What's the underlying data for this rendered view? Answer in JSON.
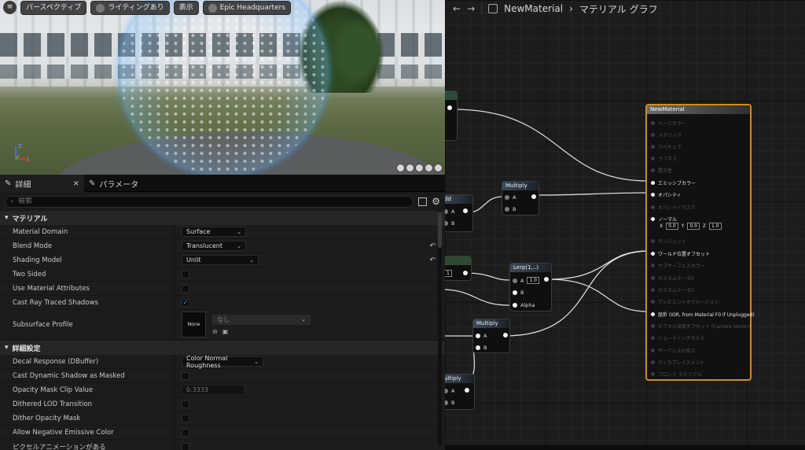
{
  "viewport": {
    "toolbar": [
      {
        "label": "パースペクティブ"
      },
      {
        "label": "ライティングあり"
      },
      {
        "label": "表示"
      },
      {
        "label": "Epic Headquarters"
      }
    ],
    "axis": {
      "z": "Z",
      "x": "X"
    }
  },
  "details": {
    "tabs": [
      {
        "label": "詳細",
        "close": "×"
      },
      {
        "label": "パラメータ"
      }
    ],
    "search_placeholder": "検索",
    "section_material": "マテリアル",
    "section_advanced": "詳細設定",
    "rows_material": [
      {
        "label": "Material Domain",
        "type": "dropdown",
        "value": "Surface",
        "reset": false
      },
      {
        "label": "Blend Mode",
        "type": "dropdown",
        "value": "Translucent",
        "reset": true
      },
      {
        "label": "Shading Model",
        "type": "dropdown",
        "value": "Unlit",
        "reset": true
      },
      {
        "label": "Two Sided",
        "type": "checkbox",
        "checked": false
      },
      {
        "label": "Use Material Attributes",
        "type": "checkbox",
        "checked": false
      },
      {
        "label": "Cast Ray Traced Shadows",
        "type": "checkbox",
        "checked": true
      }
    ],
    "subsurface": {
      "label": "Subsurface Profile",
      "thumb": "None",
      "dropdown": "なし"
    },
    "rows_advanced": [
      {
        "label": "Decal Response (DBuffer)",
        "type": "dropdown",
        "value": "Color Normal Roughness"
      },
      {
        "label": "Cast Dynamic Shadow as Masked",
        "type": "checkbox",
        "checked": false
      },
      {
        "label": "Opacity Mask Clip Value",
        "type": "number",
        "value": "0.3333"
      },
      {
        "label": "Dithered LOD Transition",
        "type": "checkbox",
        "checked": false
      },
      {
        "label": "Dither Opacity Mask",
        "type": "checkbox",
        "checked": false
      },
      {
        "label": "Allow Negative Emissive Color",
        "type": "checkbox",
        "checked": false
      },
      {
        "label": "ピクセルアニメーションがある",
        "type": "checkbox",
        "checked": false
      }
    ]
  },
  "graph": {
    "breadcrumb_material": "NewMaterial",
    "breadcrumb_sep": "›",
    "breadcrumb_graph": "マテリアル グラフ",
    "nodes": {
      "multiply_1": {
        "title": "Multiply",
        "a": "A",
        "b": "B"
      },
      "lerp": {
        "title": "Lerp(1,..)",
        "a": "A",
        "a_val": "1.0",
        "b": "B",
        "alpha": "Alpha"
      },
      "multiply_2": {
        "title": "Multiply",
        "a": "A",
        "b": "B"
      },
      "add_partial": {
        "title": "dd",
        "a": "A",
        "b": "B"
      },
      "multiply_partial": {
        "title": "ultiply",
        "a": "A",
        "b": "B"
      },
      "const_partial": {
        "value": "1"
      }
    },
    "main_node": {
      "title": "NewMaterial",
      "pins": [
        {
          "label": "ベースカラー",
          "active": false
        },
        {
          "label": "メタリック",
          "active": false
        },
        {
          "label": "スペキュラ",
          "active": false
        },
        {
          "label": "ラフネス",
          "active": false
        },
        {
          "label": "異方性",
          "active": false
        },
        {
          "label": "エミッシブカラー",
          "active": true
        },
        {
          "label": "オパシティ",
          "active": true
        },
        {
          "label": "オパシティマスク",
          "active": false
        },
        {
          "label": "ノーマル",
          "active": true
        },
        {
          "label": "タンジェント",
          "active": false
        },
        {
          "label": "ワールド位置オフセット",
          "active": true
        },
        {
          "label": "サブサーフェスカラー",
          "active": false
        },
        {
          "label": "カスタムデータ0",
          "active": false
        },
        {
          "label": "カスタムデータ1",
          "active": false
        },
        {
          "label": "アンビエントオクルージョン",
          "active": false
        },
        {
          "label": "屈折 (IOR, from Material F0 if Unplugged)",
          "active": true
        },
        {
          "label": "ピクセル深度オフセット (Camera Vector)",
          "active": false
        },
        {
          "label": "シェーディングモデル",
          "active": false
        },
        {
          "label": "サーフェスの厚さ",
          "active": false
        },
        {
          "label": "ディスプレイスメント",
          "active": false
        },
        {
          "label": "フロント マテリアル",
          "active": false
        }
      ],
      "normal_values": {
        "x_label": "X",
        "x": "0.0",
        "y_label": "Y",
        "y": "0.0",
        "z_label": "Z",
        "z": "1.0"
      }
    }
  }
}
